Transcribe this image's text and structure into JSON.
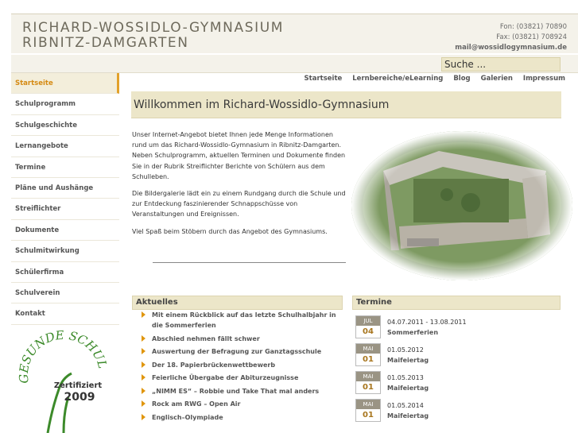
{
  "header": {
    "name_line1": "RICHARD-WOSSIDLO-GYMNASIUM",
    "name_line2": "RIBNITZ-DAMGARTEN",
    "phone": "Fon: (03821) 70890",
    "fax": "Fax: (03821) 708924",
    "email": "mail@wossidlogymnasium.de"
  },
  "search": {
    "placeholder": "Suche ..."
  },
  "topnav": [
    "Startseite",
    "Lernbereiche/eLearning",
    "Blog",
    "Galerien",
    "Impressum"
  ],
  "sidebar": {
    "items": [
      {
        "label": "Startseite",
        "active": true
      },
      {
        "label": "Schulprogramm"
      },
      {
        "label": "Schulgeschichte"
      },
      {
        "label": "Lernangebote"
      },
      {
        "label": "Termine"
      },
      {
        "label": "Pläne und Aushänge"
      },
      {
        "label": "Streiflichter"
      },
      {
        "label": "Dokumente"
      },
      {
        "label": "Schulmitwirkung"
      },
      {
        "label": "Schülerfirma"
      },
      {
        "label": "Schulverein"
      },
      {
        "label": "Kontakt"
      }
    ],
    "logo": {
      "text_arc": "GESUNDE SCHULE",
      "certified": "Zertifiziert",
      "year": "2009"
    }
  },
  "main": {
    "title": "Willkommen im Richard-Wossidlo-Gymnasium",
    "paragraphs": [
      "Unser Internet-Angebot bietet Ihnen jede Menge Informationen rund um das Richard-Wossidlo-Gymnasium in Ribnitz-Damgarten. Neben Schulprogramm, aktuellen Terminen und Dokumente finden Sie in der Rubrik Streiflichter Berichte von Schülern aus dem Schulleben.",
      "Die Bildergalerie lädt ein zu einem Rundgang durch die Schule und zur Entdeckung faszinierender Schnappschüsse von Veranstaltungen und Ereignissen.",
      "Viel Spaß beim Stöbern durch das Angebot des Gymnasiums."
    ]
  },
  "news": {
    "title": "Aktuelles",
    "items": [
      "Mit einem Rückblick auf das letzte Schulhalbjahr in die Sommerferien",
      "Abschied nehmen fällt schwer",
      "Auswertung der Befragung zur Ganztagsschule",
      "Der 18. Papierbrückenwettbewerb",
      "Feierliche Übergabe der Abiturzeugnisse",
      "„NIMM ES“ – Robbie und Take That mal anders",
      "Rock am RWG – Open Air",
      "Englisch–Olympiade"
    ]
  },
  "events": {
    "title": "Termine",
    "items": [
      {
        "month": "JUL",
        "day": "04",
        "date": "04.07.2011 - 13.08.2011",
        "name": "Sommerferien"
      },
      {
        "month": "MAI",
        "day": "01",
        "date": "01.05.2012",
        "name": "Maifeiertag"
      },
      {
        "month": "MAI",
        "day": "01",
        "date": "01.05.2013",
        "name": "Maifeiertag"
      },
      {
        "month": "MAI",
        "day": "01",
        "date": "01.05.2014",
        "name": "Maifeiertag"
      }
    ]
  },
  "colors": {
    "accent": "#e2a12a",
    "panel": "#ece6c9",
    "header_bg": "#f4f2ea",
    "logo_green": "#3c8a2a"
  },
  "icons": [
    "bullet-arrow-icon",
    "calendar-icon"
  ]
}
